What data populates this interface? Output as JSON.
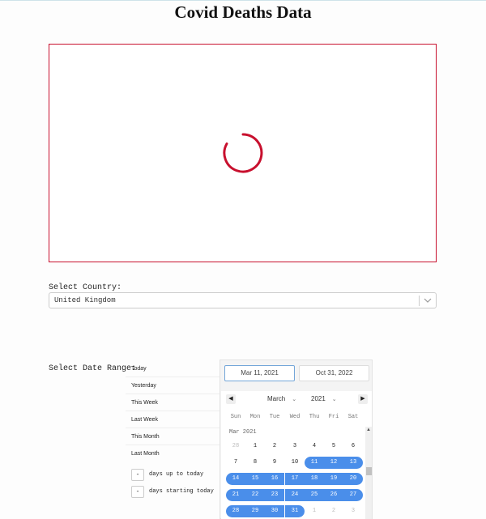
{
  "page": {
    "title": "Covid Deaths Data"
  },
  "country": {
    "label": "Select Country:",
    "selected": "United Kingdom"
  },
  "date_range": {
    "label": "Select Date Range:",
    "presets": [
      "Today",
      "Yesterday",
      "This Week",
      "Last Week",
      "This Month",
      "Last Month"
    ],
    "inputs": [
      {
        "value": "-",
        "label": "days up to today"
      },
      {
        "value": "-",
        "label": "days starting today"
      }
    ],
    "start_date": "Mar 11, 2021",
    "end_date": "Oct 31, 2022",
    "calendar": {
      "month": "March",
      "year": "2021",
      "month_label": "Mar 2021",
      "prev": "◀",
      "next": "▶",
      "weekdays": [
        "Sun",
        "Mon",
        "Tue",
        "Wed",
        "Thu",
        "Fri",
        "Sat"
      ],
      "weeks": [
        [
          "28",
          "1",
          "2",
          "3",
          "4",
          "5",
          "6"
        ],
        [
          "7",
          "8",
          "9",
          "10",
          "11",
          "12",
          "13"
        ],
        [
          "14",
          "15",
          "16",
          "17",
          "18",
          "19",
          "20"
        ],
        [
          "21",
          "22",
          "23",
          "24",
          "25",
          "26",
          "27"
        ],
        [
          "28",
          "29",
          "30",
          "31",
          "1",
          "2",
          "3"
        ]
      ]
    }
  },
  "colors": {
    "accent": "#c8102e",
    "selection": "#4a8eea"
  }
}
